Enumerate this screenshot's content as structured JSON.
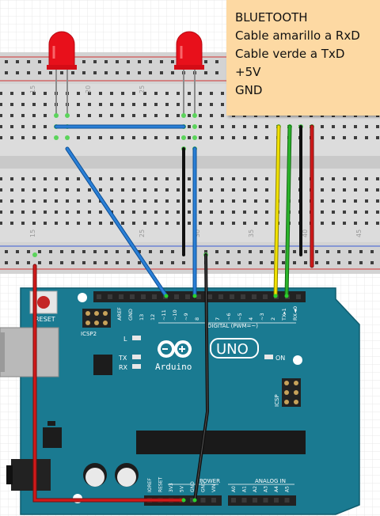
{
  "note": {
    "lines": [
      "BLUETOOTH",
      "Cable amarillo a RxD",
      "Cable verde a TxD",
      "+5V",
      "GND"
    ]
  },
  "breadboard": {
    "column_numbers": [
      "15",
      "20",
      "25",
      "30",
      "35",
      "40",
      "45"
    ],
    "bottom_column_numbers": [
      "15",
      "20",
      "25",
      "30",
      "35",
      "40",
      "45"
    ]
  },
  "arduino": {
    "brand": "Arduino",
    "model": "UNO",
    "reset_label": "RESET",
    "icsp2_label": "ICSP2",
    "icsp_label": "ICSP",
    "led_l": "L",
    "led_tx": "TX",
    "led_rx": "RX",
    "led_on": "ON",
    "digital_header": "DIGITAL (PWM=~)",
    "aref": "AREF",
    "gnd": "GND",
    "digital_pins": [
      "13",
      "12",
      "~11",
      "~10",
      "~9",
      "8",
      "7",
      "~6",
      "~5",
      "4",
      "~3",
      "2",
      "TX▸1",
      "RX◄0"
    ],
    "power_header": "POWER",
    "power_pins": [
      "IOREF",
      "RESET",
      "3V3",
      "5V",
      "GND",
      "GND",
      "VIN"
    ],
    "analog_header": "ANALOG IN",
    "analog_pins": [
      "A0",
      "A1",
      "A2",
      "A3",
      "A4",
      "A5"
    ]
  },
  "wires": {
    "blue": "#2a7fd6",
    "black": "#111111",
    "red": "#d11a1a",
    "yellow": "#f2e200",
    "green": "#2bb52b"
  },
  "colors": {
    "board": "#1a7a91",
    "breadboard": "#dcdcdc",
    "led": "#e8101b"
  }
}
